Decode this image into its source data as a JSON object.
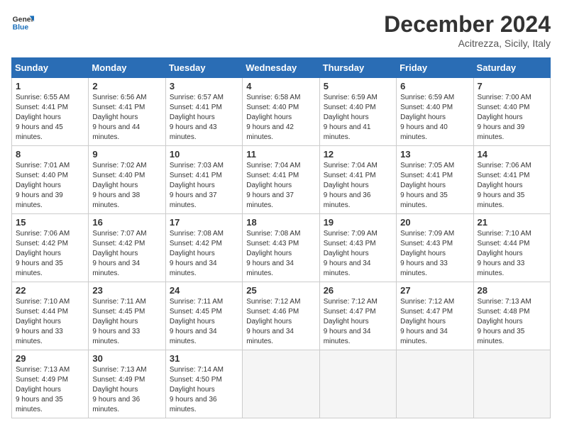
{
  "header": {
    "logo_line1": "General",
    "logo_line2": "Blue",
    "month": "December 2024",
    "location": "Acitrezza, Sicily, Italy"
  },
  "weekdays": [
    "Sunday",
    "Monday",
    "Tuesday",
    "Wednesday",
    "Thursday",
    "Friday",
    "Saturday"
  ],
  "weeks": [
    [
      {
        "day": "1",
        "rise": "6:55 AM",
        "set": "4:41 PM",
        "hours": "9 hours and 45 minutes."
      },
      {
        "day": "2",
        "rise": "6:56 AM",
        "set": "4:41 PM",
        "hours": "9 hours and 44 minutes."
      },
      {
        "day": "3",
        "rise": "6:57 AM",
        "set": "4:41 PM",
        "hours": "9 hours and 43 minutes."
      },
      {
        "day": "4",
        "rise": "6:58 AM",
        "set": "4:40 PM",
        "hours": "9 hours and 42 minutes."
      },
      {
        "day": "5",
        "rise": "6:59 AM",
        "set": "4:40 PM",
        "hours": "9 hours and 41 minutes."
      },
      {
        "day": "6",
        "rise": "6:59 AM",
        "set": "4:40 PM",
        "hours": "9 hours and 40 minutes."
      },
      {
        "day": "7",
        "rise": "7:00 AM",
        "set": "4:40 PM",
        "hours": "9 hours and 39 minutes."
      }
    ],
    [
      {
        "day": "8",
        "rise": "7:01 AM",
        "set": "4:40 PM",
        "hours": "9 hours and 39 minutes."
      },
      {
        "day": "9",
        "rise": "7:02 AM",
        "set": "4:40 PM",
        "hours": "9 hours and 38 minutes."
      },
      {
        "day": "10",
        "rise": "7:03 AM",
        "set": "4:41 PM",
        "hours": "9 hours and 37 minutes."
      },
      {
        "day": "11",
        "rise": "7:04 AM",
        "set": "4:41 PM",
        "hours": "9 hours and 37 minutes."
      },
      {
        "day": "12",
        "rise": "7:04 AM",
        "set": "4:41 PM",
        "hours": "9 hours and 36 minutes."
      },
      {
        "day": "13",
        "rise": "7:05 AM",
        "set": "4:41 PM",
        "hours": "9 hours and 35 minutes."
      },
      {
        "day": "14",
        "rise": "7:06 AM",
        "set": "4:41 PM",
        "hours": "9 hours and 35 minutes."
      }
    ],
    [
      {
        "day": "15",
        "rise": "7:06 AM",
        "set": "4:42 PM",
        "hours": "9 hours and 35 minutes."
      },
      {
        "day": "16",
        "rise": "7:07 AM",
        "set": "4:42 PM",
        "hours": "9 hours and 34 minutes."
      },
      {
        "day": "17",
        "rise": "7:08 AM",
        "set": "4:42 PM",
        "hours": "9 hours and 34 minutes."
      },
      {
        "day": "18",
        "rise": "7:08 AM",
        "set": "4:43 PM",
        "hours": "9 hours and 34 minutes."
      },
      {
        "day": "19",
        "rise": "7:09 AM",
        "set": "4:43 PM",
        "hours": "9 hours and 34 minutes."
      },
      {
        "day": "20",
        "rise": "7:09 AM",
        "set": "4:43 PM",
        "hours": "9 hours and 33 minutes."
      },
      {
        "day": "21",
        "rise": "7:10 AM",
        "set": "4:44 PM",
        "hours": "9 hours and 33 minutes."
      }
    ],
    [
      {
        "day": "22",
        "rise": "7:10 AM",
        "set": "4:44 PM",
        "hours": "9 hours and 33 minutes."
      },
      {
        "day": "23",
        "rise": "7:11 AM",
        "set": "4:45 PM",
        "hours": "9 hours and 33 minutes."
      },
      {
        "day": "24",
        "rise": "7:11 AM",
        "set": "4:45 PM",
        "hours": "9 hours and 34 minutes."
      },
      {
        "day": "25",
        "rise": "7:12 AM",
        "set": "4:46 PM",
        "hours": "9 hours and 34 minutes."
      },
      {
        "day": "26",
        "rise": "7:12 AM",
        "set": "4:47 PM",
        "hours": "9 hours and 34 minutes."
      },
      {
        "day": "27",
        "rise": "7:12 AM",
        "set": "4:47 PM",
        "hours": "9 hours and 34 minutes."
      },
      {
        "day": "28",
        "rise": "7:13 AM",
        "set": "4:48 PM",
        "hours": "9 hours and 35 minutes."
      }
    ],
    [
      {
        "day": "29",
        "rise": "7:13 AM",
        "set": "4:49 PM",
        "hours": "9 hours and 35 minutes."
      },
      {
        "day": "30",
        "rise": "7:13 AM",
        "set": "4:49 PM",
        "hours": "9 hours and 36 minutes."
      },
      {
        "day": "31",
        "rise": "7:14 AM",
        "set": "4:50 PM",
        "hours": "9 hours and 36 minutes."
      },
      null,
      null,
      null,
      null
    ]
  ]
}
